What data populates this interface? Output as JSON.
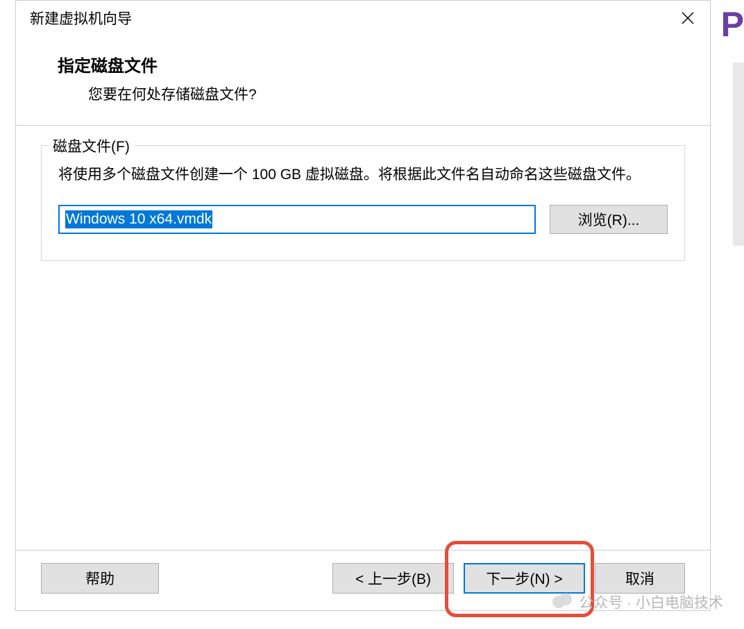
{
  "background": {
    "letter": "P"
  },
  "dialog": {
    "title": "新建虚拟机向导",
    "header": {
      "title": "指定磁盘文件",
      "subtitle": "您要在何处存储磁盘文件?"
    },
    "fieldset": {
      "legend": "磁盘文件(F)",
      "description": "将使用多个磁盘文件创建一个 100 GB 虚拟磁盘。将根据此文件名自动命名这些磁盘文件。",
      "file_value": "Windows 10 x64.vmdk",
      "browse_label": "浏览(R)..."
    },
    "footer": {
      "help": "帮助",
      "back": "< 上一步(B)",
      "next": "下一步(N) >",
      "cancel": "取消"
    }
  },
  "watermark": {
    "text": "公众号 · 小白电脑技术"
  }
}
